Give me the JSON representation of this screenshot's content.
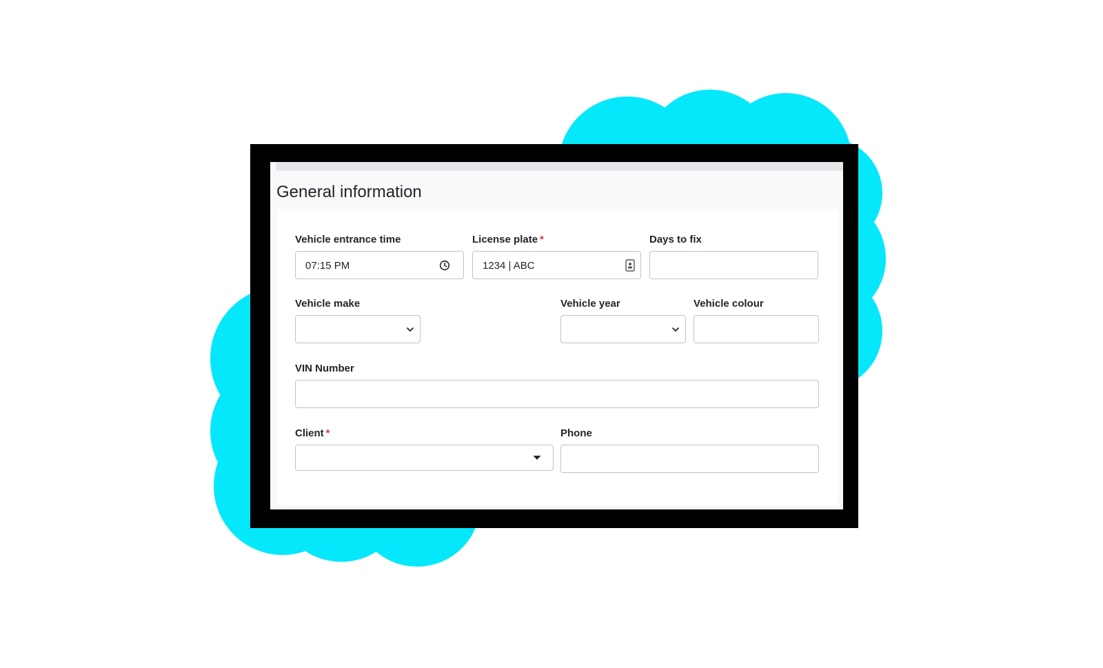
{
  "section_title": "General information",
  "required_marker": "*",
  "fields": {
    "entrance_time": {
      "label": "Vehicle entrance time",
      "value": "07:15  PM",
      "icon": "clock-icon"
    },
    "license_plate": {
      "label": "License plate",
      "value": "1234 | ABC",
      "icon": "contact-card-icon"
    },
    "days_to_fix": {
      "label": "Days to fix",
      "value": ""
    },
    "vehicle_make": {
      "label": "Vehicle make",
      "value": "",
      "icon": "chevron-down-icon"
    },
    "vehicle_year": {
      "label": "Vehicle year",
      "value": "",
      "icon": "chevron-down-icon"
    },
    "vehicle_colour": {
      "label": "Vehicle colour",
      "value": ""
    },
    "vin": {
      "label": "VIN Number",
      "value": ""
    },
    "client": {
      "label": "Client",
      "value": "",
      "icon": "caret-down-icon"
    },
    "phone": {
      "label": "Phone",
      "value": ""
    }
  },
  "colors": {
    "cloud": "#05e8fb",
    "frame": "#000000",
    "required": "#dc3545"
  }
}
